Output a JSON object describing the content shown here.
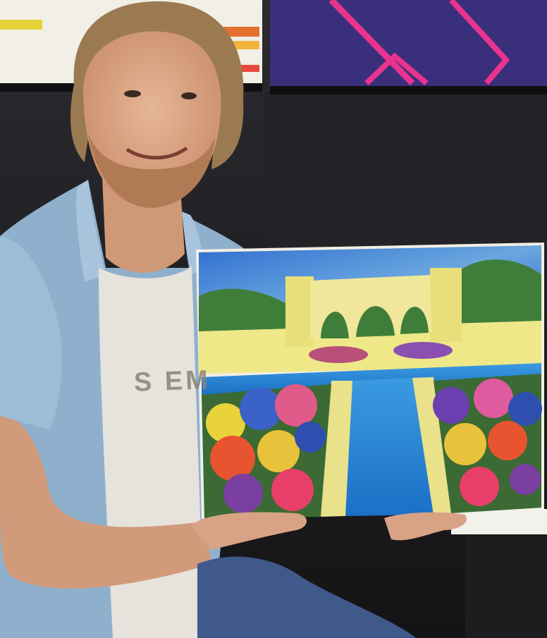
{
  "photo": {
    "shirt_print_text": "S EM",
    "colors": {
      "background_dark": "#1a1a1c",
      "monitor_left": "#f1efe6",
      "monitor_right": "#3a2f7a",
      "neon_pink": "#e8338f",
      "shirt_blue": "#8fb0cc",
      "tshirt_white": "#e6e2dc",
      "skin": "#d9a487",
      "hair": "#9b7a52",
      "jeans": "#3f5a8a",
      "sky": "#3f7fd0",
      "palace_yellow": "#eee888",
      "water_blue": "#1f7fd2",
      "hedge_green": "#3f7e3a"
    }
  }
}
